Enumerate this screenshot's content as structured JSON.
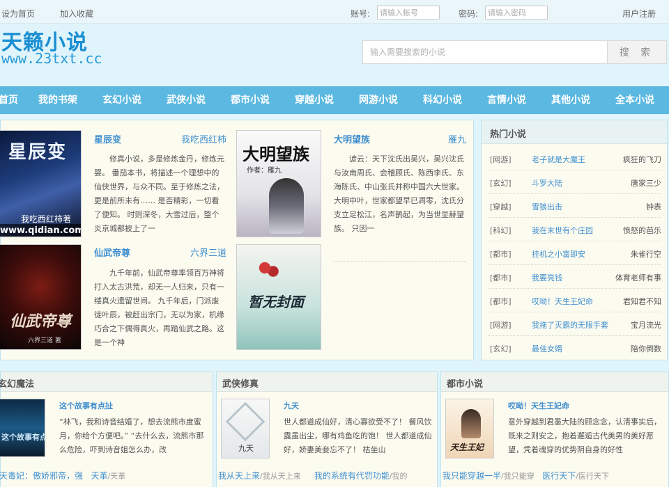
{
  "topbar": {
    "set_home": "设为首页",
    "add_fav": "加入收藏",
    "account_label": "账号:",
    "account_placeholder": "请输入帐号",
    "password_label": "密码:",
    "password_placeholder": "请输入密码",
    "register": "用户注册"
  },
  "header": {
    "logo_title": "天籁小说",
    "logo_url": "www.23txt.cc",
    "search_placeholder": "输入需要搜索的小说",
    "search_button": "搜 索"
  },
  "nav": [
    "首页",
    "我的书架",
    "玄幻小说",
    "武侠小说",
    "都市小说",
    "穿越小说",
    "网游小说",
    "科幻小说",
    "言情小说",
    "其他小说",
    "全本小说"
  ],
  "recommend": [
    {
      "title": "星辰变",
      "author": "我吃西红柿",
      "desc": "修真小说，多是修炼金丹，修炼元婴。 番茄本书，将描述一个理想中的仙侠世界，与众不同。至于修炼之法，更是前所未有…… 是否精彩，一切看了便知。 时则深冬，大雪过后，整个炎京城都披上了一",
      "cover_text": "星辰变",
      "cover_sub": "我吃西红柿著",
      "cover_site": "www.qidian.com"
    },
    {
      "title": "大明望族",
      "author": "雁九",
      "desc": "谚云：天下沈氏出吴兴，吴兴沈氏与汝南周氏、会稽顾氏、陈西李氏、东海陈氏、中山张氏并称中国六大世家。 大明中叶，世家都望早已凋零，沈氏分支立足松江，名声鹊起，为当世显赫望族。 只因一",
      "cover_text": "大明望族",
      "cover_sub": "作者：雁九"
    },
    {
      "title": "仙武帝尊",
      "author": "六界三道",
      "desc": "九千年前，仙武帝尊率领百万神将打入太古洪荒，却无一人归来，只有一缕真火遗留世间。 九千年后，门派废徒叶辰，被赶出宗门，无以为家，机缘巧合之下偶得真火，再踏仙武之路。这是一个神",
      "cover_text": "仙武帝尊",
      "cover_sub": "六界三道 著"
    },
    {
      "cover_text": "暂无封面"
    }
  ],
  "hot": {
    "title": "热门小说",
    "items": [
      {
        "cat": "[网游]",
        "title": "老子就是大魔王",
        "author": "疯狂的飞刀"
      },
      {
        "cat": "[玄幻]",
        "title": "斗罗大陆",
        "author": "唐家三少"
      },
      {
        "cat": "[穿越]",
        "title": "雪狼出击",
        "author": "钟表"
      },
      {
        "cat": "[科幻]",
        "title": "我在末世有个庄园",
        "author": "愤怒的芭乐"
      },
      {
        "cat": "[都市]",
        "title": "挂机之小富即安",
        "author": "朱雀行空"
      },
      {
        "cat": "[都市]",
        "title": "我要亮钱",
        "author": "体育老师有事"
      },
      {
        "cat": "[都市]",
        "title": "哎呦！天生王妃命",
        "author": "君知君不知"
      },
      {
        "cat": "[网游]",
        "title": "我拖了灭霸的无限手套",
        "author": "宝月流光"
      },
      {
        "cat": "[玄幻]",
        "title": "最佳女婿",
        "author": "陪你倒数"
      }
    ]
  },
  "columns": [
    {
      "title": "玄幻魔法",
      "book_title": "这个故事有点扯",
      "desc": "“林飞，我和诗音结婚了，想去流熊市度蜜月，你给个方便吧。” “去什么去，流熊市那么危险，吓到诗音姐怎么办，改",
      "cover_text": "这个故事有点扯",
      "link1": "天毒妃：傲娇邪帝，强",
      "link2": "天革",
      "link2_sub": "/天革"
    },
    {
      "title": "武侠修真",
      "book_title": "九天",
      "desc": "世人都道成仙好，清心寡欲受不了！ 餐风饮露虽出尘，哪有鸡鱼吃的饱！ 世人都道成仙好，娇妻美妾忘不了！ 枯坐山",
      "cover_text": "九天",
      "link1": "我从天上来",
      "link1_sub": "/我从天上来",
      "link2": "我的系统有代罚功能",
      "link2_sub": "/我的"
    },
    {
      "title": "都市小说",
      "book_title": "哎呦！天生王妃命",
      "desc": "意外穿越到君墨大陆的顾念念，认清事实后，既来之则安之，抱着邂逅古代美男的美好愿望，凭着魂穿的优势阴自身的好性",
      "cover_text": "天生王妃",
      "link1": "我只能穿越一半",
      "link1_sub": "/我只能穿",
      "link2": "医行天下",
      "link2_sub": "/医行天下"
    }
  ],
  "colors": {
    "nav_bg": "#5bb8e1",
    "link_blue": "#3f8fcf",
    "logo_blue": "#1a8ed2",
    "panel_bg": "#fcfbf0"
  }
}
